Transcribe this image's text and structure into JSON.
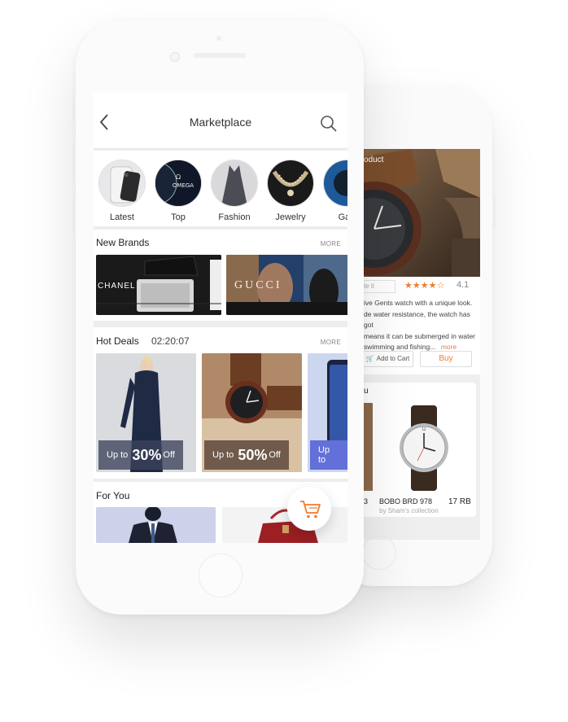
{
  "app": {
    "title": "Marketplace"
  },
  "categories": [
    {
      "label": "Latest",
      "icon": "phone-image"
    },
    {
      "label": "Top",
      "icon": "omega-watch-image",
      "brand_text": "OMEGA"
    },
    {
      "label": "Fashion",
      "icon": "dress-image"
    },
    {
      "label": "Jewelry",
      "icon": "necklace-image"
    },
    {
      "label": "Gad",
      "icon": "gadget-image"
    }
  ],
  "new_brands": {
    "title": "New Brands",
    "more": "MORE",
    "brands": [
      "CHANEL",
      "GUCCI"
    ]
  },
  "hot_deals": {
    "title": "Hot Deals",
    "timer": "02:20:07",
    "more": "MORE",
    "items": [
      {
        "prefix": "Up to",
        "percent": "30%",
        "suffix": "Off"
      },
      {
        "prefix": "Up to",
        "percent": "50%",
        "suffix": "Off"
      },
      {
        "prefix": "Up to",
        "percent": "",
        "suffix": ""
      }
    ]
  },
  "for_you": {
    "title": "For You"
  },
  "back_phone": {
    "product_label": "oduct",
    "rate_placeholder": "te it",
    "stars": "★★★★☆",
    "rating": "4.1",
    "description_lines": [
      "ive Gents watch with a unique look.",
      "de water resistance, the watch has got",
      "means it can be submerged in water",
      "swimming and fishing..."
    ],
    "more_link": "more",
    "add_to_cart": "Add to Cart",
    "buy": "Buy",
    "suggest_title": "u",
    "item_left_price": "3",
    "item_name": "BOBO BRD 978",
    "item_price": "17 RB",
    "item_seller": "by Sham's collection"
  },
  "colors": {
    "accent": "#f07b2f",
    "deal_tag": "#3c415a",
    "blue_card": "#6270d8"
  }
}
